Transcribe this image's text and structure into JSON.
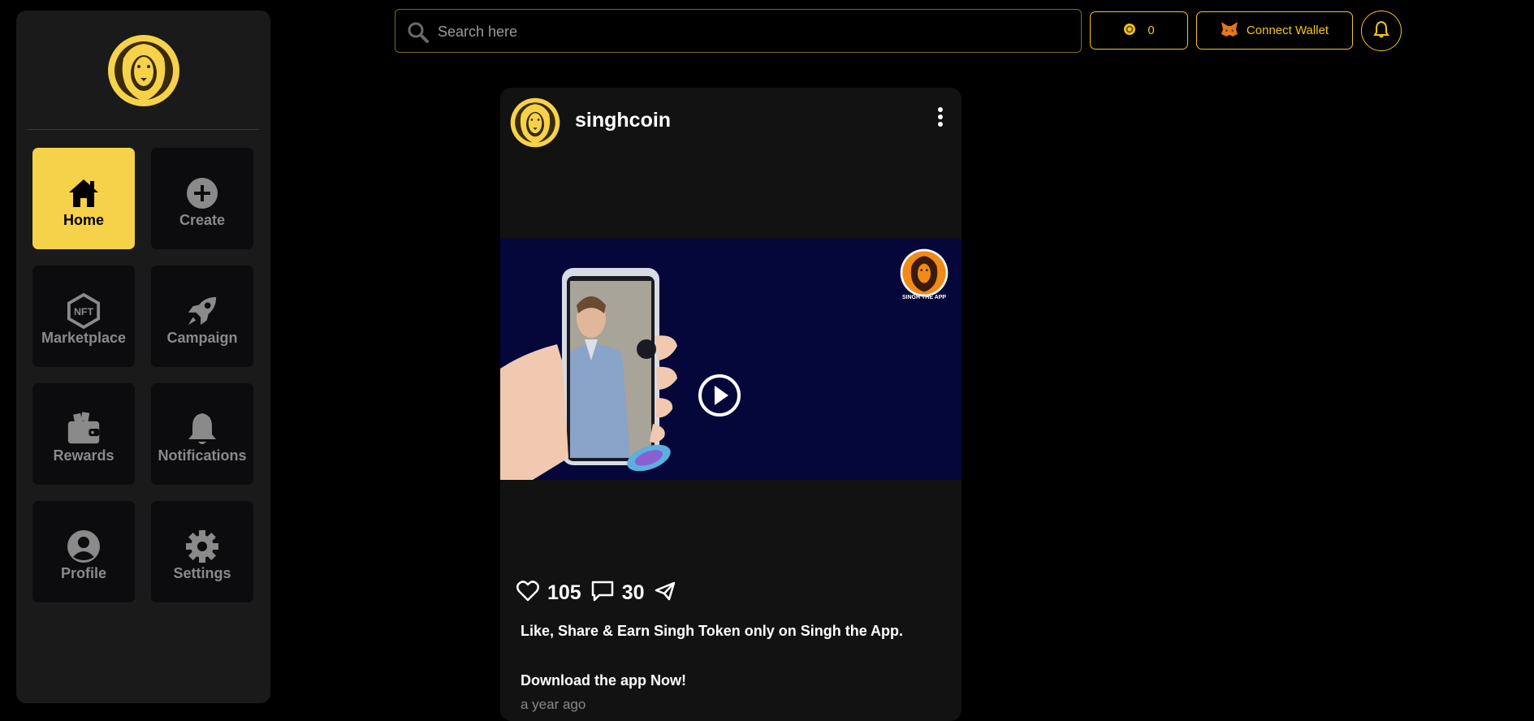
{
  "colors": {
    "accent": "#f5d24a",
    "gold": "#f5c518",
    "sidebar_bg": "#1a1a1a",
    "tile_bg": "#0c0c0f",
    "card_bg": "#121212",
    "media_bg": "#05073a"
  },
  "sidebar": {
    "logo_icon": "lion-logo-icon",
    "items": [
      {
        "label": "Home",
        "icon": "home-icon",
        "active": true
      },
      {
        "label": "Create",
        "icon": "plus-circle-icon"
      },
      {
        "label": "Marketplace",
        "icon": "nft-hexagon-icon"
      },
      {
        "label": "Campaign",
        "icon": "rocket-icon"
      },
      {
        "label": "Rewards",
        "icon": "wallet-icon"
      },
      {
        "label": "Notifications",
        "icon": "bell-icon"
      },
      {
        "label": "Profile",
        "icon": "user-circle-icon"
      },
      {
        "label": "Settings",
        "icon": "gear-icon"
      }
    ]
  },
  "topbar": {
    "search_placeholder": "Search here",
    "coin_balance": "0",
    "connect_wallet_label": "Connect Wallet"
  },
  "post": {
    "username": "singhcoin",
    "media_brand_text": "SINGH THE APP",
    "likes": "105",
    "comments": "30",
    "caption_line1": "Like, Share & Earn Singh Token only on Singh the App.",
    "caption_line2": "Download the app Now!",
    "timestamp": "a year ago"
  }
}
